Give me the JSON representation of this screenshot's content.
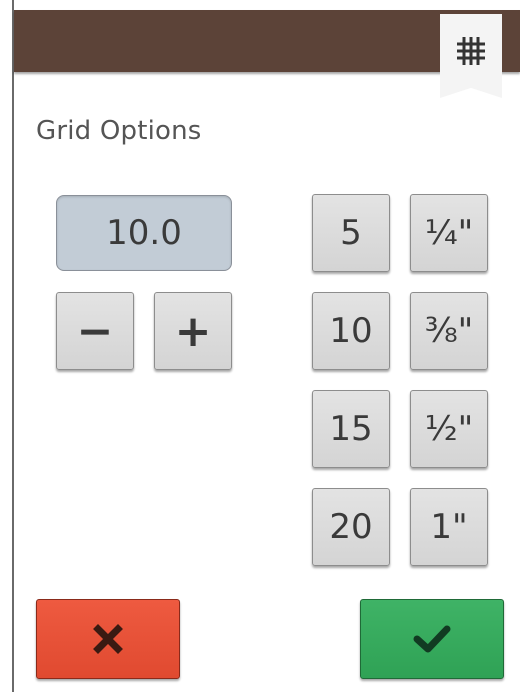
{
  "panel": {
    "title": "Grid Options",
    "tab_icon": "grid-icon"
  },
  "grid_size": {
    "value": "10.0",
    "decrement_label": "−",
    "increment_label": "+"
  },
  "presets": {
    "metric": [
      "5",
      "10",
      "15",
      "20"
    ],
    "imperial": [
      "¼\"",
      "⅜\"",
      "½\"",
      "1\""
    ]
  },
  "actions": {
    "cancel_icon": "close-icon",
    "confirm_icon": "checkmark-icon"
  },
  "colors": {
    "header": "#5c4338",
    "cancel": "#e8533a",
    "confirm": "#35aa5c",
    "value_field": "#c2ccd6"
  }
}
